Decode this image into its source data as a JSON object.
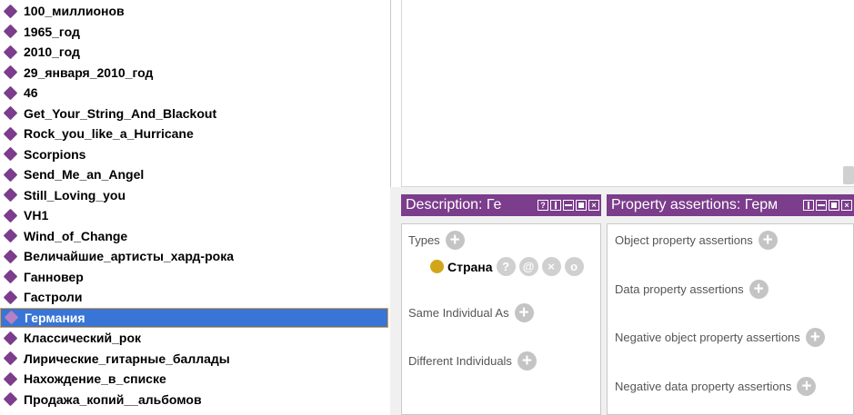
{
  "individuals": [
    {
      "label": "100_миллионов",
      "selected": false
    },
    {
      "label": "1965_год",
      "selected": false
    },
    {
      "label": "2010_год",
      "selected": false
    },
    {
      "label": "29_января_2010_год",
      "selected": false
    },
    {
      "label": "46",
      "selected": false
    },
    {
      "label": "Get_Your_String_And_Blackout",
      "selected": false
    },
    {
      "label": "Rock_you_like_a_Hurricane",
      "selected": false
    },
    {
      "label": "Scorpions",
      "selected": false
    },
    {
      "label": "Send_Me_an_Angel",
      "selected": false
    },
    {
      "label": "Still_Loving_you",
      "selected": false
    },
    {
      "label": "VH1",
      "selected": false
    },
    {
      "label": "Wind_of_Change",
      "selected": false
    },
    {
      "label": "Величайшие_артисты_хард-рока",
      "selected": false
    },
    {
      "label": "Ганновер",
      "selected": false
    },
    {
      "label": "Гастроли",
      "selected": false
    },
    {
      "label": "Германия",
      "selected": true
    },
    {
      "label": "Классический_рок",
      "selected": false
    },
    {
      "label": "Лирические_гитарные_баллады",
      "selected": false
    },
    {
      "label": "Нахождение_в_списке",
      "selected": false
    },
    {
      "label": "Продажа_копий__альбомов",
      "selected": false
    }
  ],
  "description_panel": {
    "title": "Description: Ге",
    "types_label": "Types",
    "type_entry": "Страна",
    "same_individual_label": "Same Individual As",
    "different_individuals_label": "Different Individuals"
  },
  "property_panel": {
    "title": "Property assertions: Герм",
    "object_label": "Object property assertions",
    "data_label": "Data property assertions",
    "neg_object_label": "Negative object property assertions",
    "neg_data_label": "Negative data property assertions"
  },
  "header_buttons": {
    "help": "?",
    "close": "×"
  },
  "type_buttons": {
    "explain": "?",
    "annotate": "@",
    "delete": "×",
    "edit": "o"
  },
  "plus_glyph": "+",
  "colors": {
    "header": "#7b3d8c",
    "selection": "#3875d7",
    "individual_icon": "#7b3d8c",
    "class_icon": "#d2a61a"
  }
}
